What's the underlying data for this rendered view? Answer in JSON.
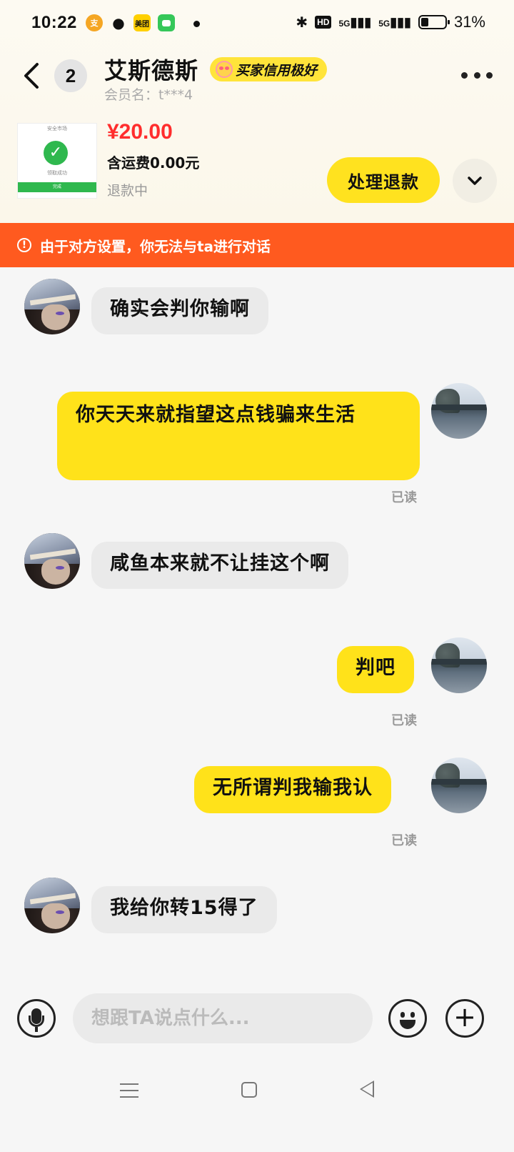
{
  "status_bar": {
    "time": "10:22",
    "app_icons": [
      "alipay-icon",
      "wechat-icon",
      "meituan-icon",
      "messages-icon"
    ],
    "meituan_label": "美团",
    "hd_label": "HD",
    "signal1_label": "5G",
    "signal2_label": "5G",
    "battery_percent": "31%",
    "battery_level": 0.31
  },
  "header": {
    "unread_count": "2",
    "username": "艾斯德斯",
    "credit_badge": "买家信用极好",
    "member_name": "会员名：t***4"
  },
  "product": {
    "thumbnail": {
      "top_text": "安全市场",
      "check_text": "✓",
      "caption": "领取成功",
      "button_text": "完成"
    },
    "price": "¥20.00",
    "shipping": "含运费0.00元",
    "status": "退款中",
    "refund_button": "处理退款"
  },
  "notice": {
    "icon": "!",
    "text": "由于对方设置，你无法与ta进行对话"
  },
  "messages": [
    {
      "side": "left",
      "text": "确实会判你输啊"
    },
    {
      "side": "right",
      "text": "你天天来就指望这点钱骗来生活",
      "read": "已读"
    },
    {
      "side": "left",
      "text": "咸鱼本来就不让挂这个啊"
    },
    {
      "side": "right",
      "text": "判吧",
      "read": "已读"
    },
    {
      "side": "right",
      "text": "无所谓判我输我认",
      "read": "已读"
    },
    {
      "side": "left",
      "text": "我给你转15得了"
    }
  ],
  "input": {
    "placeholder": "想跟TA说点什么..."
  },
  "colors": {
    "accent_yellow": "#ffe21a",
    "notice_orange": "#ff5a1f",
    "price_red": "#ff2d2d"
  }
}
